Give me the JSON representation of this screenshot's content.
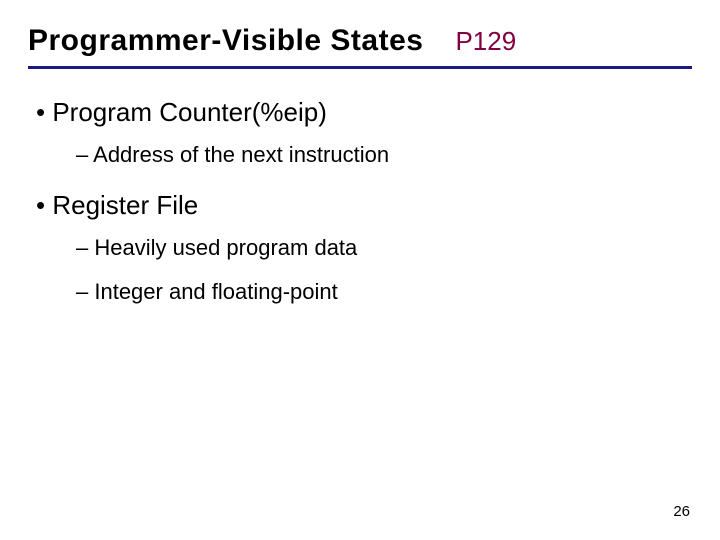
{
  "header": {
    "title": "Programmer-Visible States",
    "page_ref": "P129"
  },
  "bullets": [
    {
      "label": "Program Counter(%eip)",
      "subs": [
        "Address of the next instruction"
      ]
    },
    {
      "label": "Register File",
      "subs": [
        "Heavily used program data",
        "Integer and floating-point"
      ]
    }
  ],
  "slide_number": "26"
}
